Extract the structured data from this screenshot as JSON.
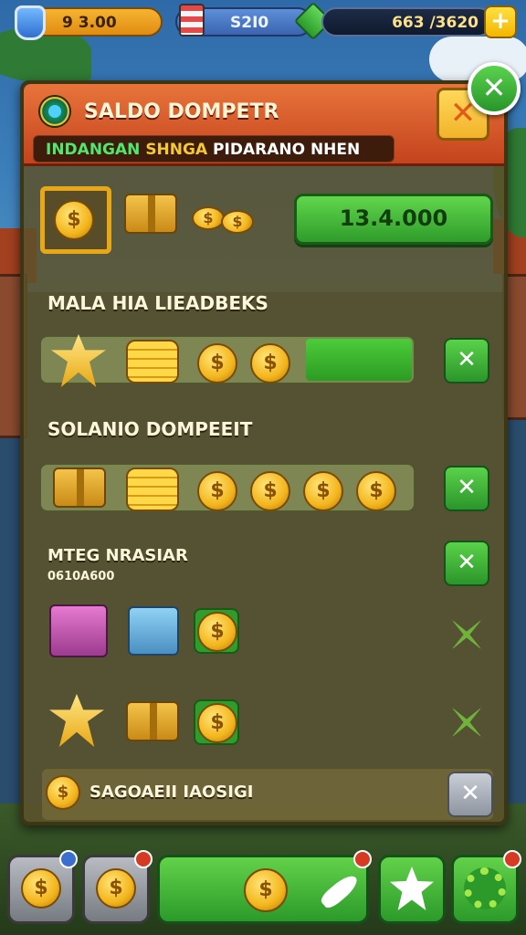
{
  "topbar": {
    "gold_value": "9  3.00",
    "flag_value": "S2I0",
    "gems_value": "663 /3620",
    "plus_label": "+"
  },
  "panel": {
    "title": "SALDO DOMPETR",
    "subtitle_parts": [
      "INDANGAN",
      "SHNGA",
      "PIDARANO NHEN"
    ],
    "close_label": "✕",
    "round_close_label": "✕",
    "balance_value": "13.4.000"
  },
  "sections": {
    "section1_label": "MALA HIA LIEADBEKS",
    "section2_label": "SOLANIO DOMPEEIT",
    "section3_label": "MTEG NRASIAR",
    "section3_sub": "0610A600",
    "footer_label": "SAGOAEII IAOSIGI"
  },
  "labels": {
    "coin_symbol": "$",
    "close_symbol": "✕"
  },
  "colors": {
    "accent_green": "#2f9c2b",
    "header_orange": "#c4431d",
    "gold": "#f3b51c"
  }
}
